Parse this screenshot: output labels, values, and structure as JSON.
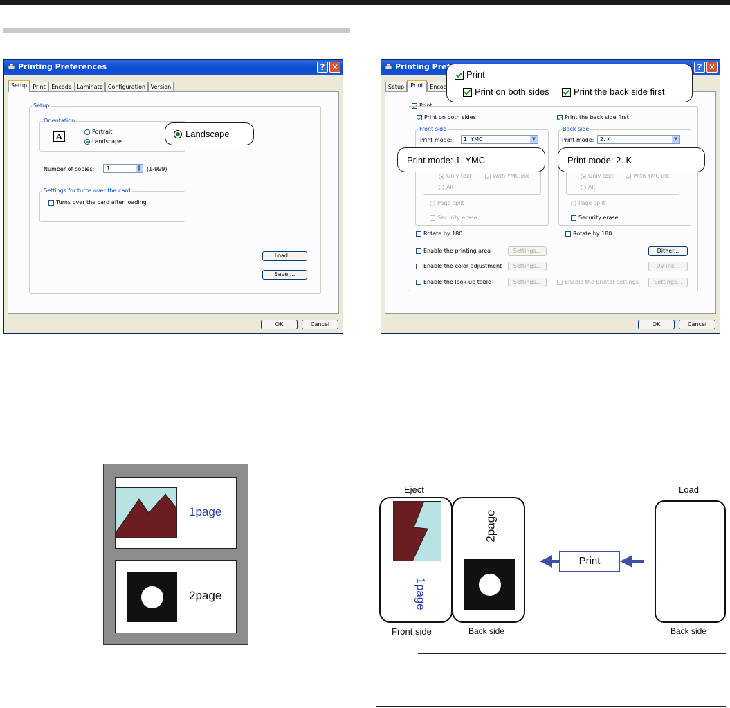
{
  "window": {
    "title": "Printing Preferences",
    "help_glyph": "?",
    "close_glyph": "✕",
    "ok": "OK",
    "cancel": "Cancel"
  },
  "tabs": [
    "Setup",
    "Print",
    "Encode",
    "Laminate",
    "Configuration",
    "Version"
  ],
  "setup": {
    "group_setup": "Setup",
    "group_orientation": "Orientation",
    "orientation_glyph": "A",
    "portrait": "Portrait",
    "landscape": "Landscape",
    "copies_label": "Number of copies:",
    "copies_value": "1",
    "copies_range": "(1-999)",
    "group_turns": "Settings for turns over the card",
    "turns_option": "Turns over the card after loading",
    "load": "Load ...",
    "save": "Save ...",
    "callout_landscape": "Landscape"
  },
  "print_tab": {
    "print": "Print",
    "both_sides": "Print on both sides",
    "back_first": "Print the back side first",
    "front_side": "Front side",
    "back_side": "Back side",
    "print_mode_label": "Print mode:",
    "front_mode": "1. YMC",
    "back_mode": "2. K",
    "only_text": "Only text",
    "with_ymc_ink": "With YMC ink",
    "all": "All",
    "page_split": "Page split",
    "security_erase": "Security erase",
    "rotate": "Rotate by 180",
    "enable_printing_area": "Enable the printing area",
    "enable_color_adjustment": "Enable the color adjustment",
    "enable_lookup_table": "Enable the look-up table",
    "enable_printer_settings": "Enable the printer settings",
    "settings": "Settings...",
    "dither": "Dither...",
    "uv_ink": "UV ink...",
    "callout_print": "Print",
    "callout_both_sides": "Print on both sides",
    "callout_back_first": "Print the back side first",
    "callout_front_mode": "Print mode:  1. YMC",
    "callout_back_mode": "Print mode:  2. K"
  },
  "layout_diagram": {
    "page1": "1page",
    "page2": "2page"
  },
  "flow_diagram": {
    "eject": "Eject",
    "load": "Load",
    "print_button": "Print",
    "front_side": "Front side",
    "back_side_middle": "Back side",
    "back_side_right": "Back side",
    "page1": "1page",
    "page2": "2page"
  },
  "colors": {
    "mountain": "#6b1e22",
    "sky": "#b9e3e3",
    "page_label_blue": "#2b3fb0",
    "arrow_blue": "#3e4fa8",
    "frame_gray": "#8c8c8c"
  }
}
